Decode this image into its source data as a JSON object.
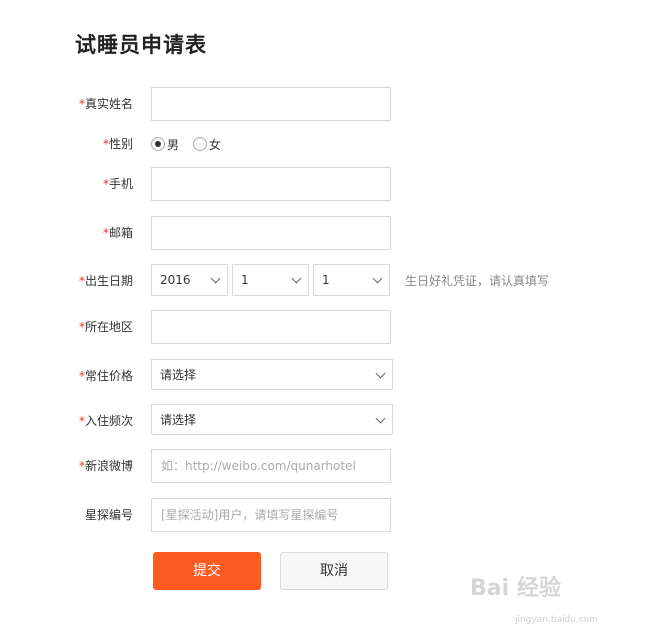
{
  "form": {
    "title": "试睡员申请表",
    "required_mark": "*",
    "name": {
      "label": "真实姓名",
      "value": ""
    },
    "gender": {
      "label": "性别",
      "options": [
        "男",
        "女"
      ],
      "selected": "男"
    },
    "phone": {
      "label": "手机",
      "value": ""
    },
    "email": {
      "label": "邮箱",
      "value": ""
    },
    "birthday": {
      "label": "出生日期",
      "year": "2016",
      "month": "1",
      "day": "1",
      "hint": "生日好礼凭证，请认真填写"
    },
    "region": {
      "label": "所在地区",
      "value": ""
    },
    "price": {
      "label": "常住价格",
      "selected": "请选择"
    },
    "frequency": {
      "label": "入住频次",
      "selected": "请选择"
    },
    "weibo": {
      "label": "新浪微博",
      "placeholder": "如：http://weibo.com/qunarhotel"
    },
    "star_id": {
      "label": "星探编号",
      "placeholder": "[星探活动]用户，请填写星探编号"
    },
    "submit_label": "提交",
    "cancel_label": "取消"
  },
  "watermark": {
    "text": "Bai 经验",
    "sub": "jingyan.baidu.com"
  }
}
